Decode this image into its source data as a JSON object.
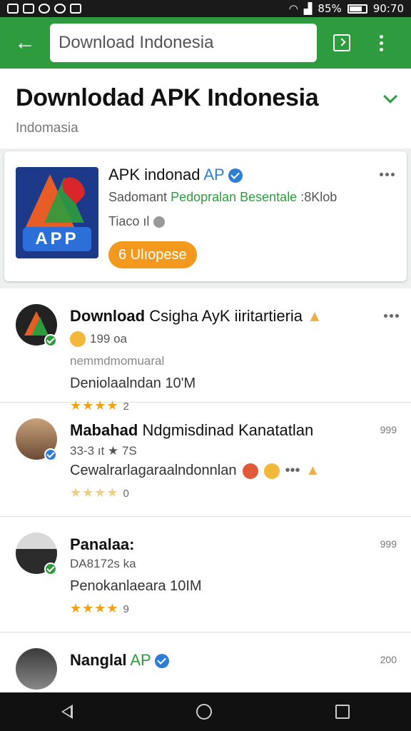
{
  "status_bar": {
    "battery": "85%",
    "time": "90:70"
  },
  "appbar": {
    "search_value": "Download Indonesia",
    "accent_color": "#2e9c3e"
  },
  "header": {
    "title": "Downlodad APK Indonesia",
    "subtitle": "Indomasia"
  },
  "app_card": {
    "name": "APK indonad ",
    "name_accent": "AP",
    "meta_prefix": "Sadomant ",
    "meta_green": "Pedopralan Besentale",
    "meta_suffix": " :8Klob",
    "meta2": "Tiaco ıl",
    "button_label": "6 Ulıopese",
    "logo_text": "APP"
  },
  "list": {
    "items": [
      {
        "name_bold": "Download",
        "name_rest": " Csigha AyK iiritartieria",
        "line1": "199 oa",
        "line2": "nemmdmomuaral",
        "desc": "Deniolaalndan 10'M",
        "stars": "★★★★",
        "star_count": "2",
        "count": ""
      },
      {
        "name_bold": "Mabahad",
        "name_rest": " Ndgmisdinad Kanatatlan",
        "line1": "33-3 ıt ★ 7S",
        "line2": "",
        "desc": "Cewalrarlagaraalndonnlan",
        "stars": "★★★★",
        "star_count": "0",
        "count": "999"
      },
      {
        "name_bold": "Panalaa:",
        "name_rest": "",
        "line1": "DA8172s ka",
        "line2": "",
        "desc": "Penokanlaeara 10IM",
        "stars": "★★★★",
        "star_count": "9",
        "count": "999"
      },
      {
        "name_bold": "Nanglal",
        "name_rest": " AP",
        "line1": "",
        "line2": "",
        "desc": "",
        "stars": "",
        "star_count": "",
        "count": "200"
      }
    ]
  }
}
